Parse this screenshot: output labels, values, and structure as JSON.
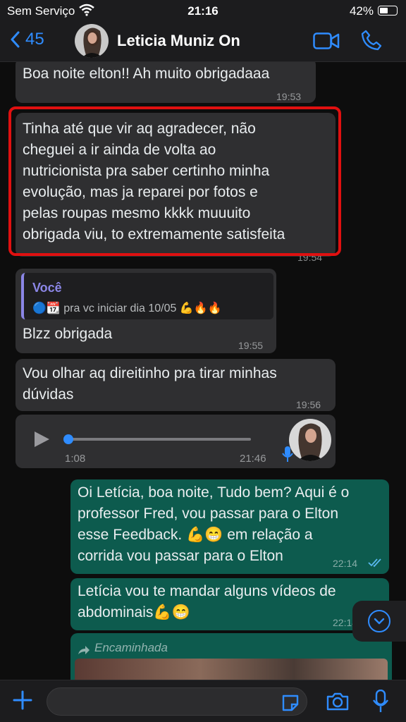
{
  "status_bar": {
    "carrier": "Sem Serviço",
    "time": "21:16",
    "battery": "42%"
  },
  "header": {
    "back_count": "45",
    "contact_name": "Leticia Muniz On"
  },
  "messages": [
    {
      "lines": [
        "Boa noite elton!! Ah muito obrigadaaa"
      ],
      "time": "19:53"
    },
    {
      "lines": [
        "Tinha até que vir aq agradecer, não",
        "cheguei a ir ainda de volta ao",
        "nutricionista pra saber certinho minha",
        "evolução, mas ja reparei por fotos e",
        "pelas roupas mesmo kkkk muuuito",
        "obrigada viu, to extremamente satisfeita"
      ],
      "time": "19:54"
    },
    {
      "quote_author": "Você",
      "quote_text": "🔵📆 pra vc iniciar dia 10/05 💪🔥🔥",
      "lines": [
        "Blzz obrigada"
      ],
      "time": "19:55"
    },
    {
      "lines": [
        "Vou olhar aq direitinho pra tirar minhas",
        "dúvidas"
      ],
      "time": "19:56"
    },
    {
      "voice_duration": "1:08",
      "time": "21:46"
    },
    {
      "lines": [
        "Oi Letícia, boa noite, Tudo bem? Aqui é o",
        "professor Fred, vou passar para o Elton",
        "esse Feedback. 💪😁 em relação a",
        "corrida vou passar para o Elton"
      ],
      "time": "22:14"
    },
    {
      "lines": [
        "Letícia vou te mandar alguns vídeos de",
        "abdominais💪😁"
      ],
      "time": "22:14"
    },
    {
      "forwarded_label": "Encaminhada"
    }
  ],
  "composer": {
    "placeholder": ""
  },
  "colors": {
    "accent": "#2f8cff",
    "incoming_bubble": "#2f2f31",
    "outgoing_bubble": "#0d5b4e",
    "highlight": "#e01010",
    "quote_author": "#8b86e6"
  },
  "icons": [
    "wifi-icon",
    "battery-icon",
    "back-chevron-icon",
    "video-call-icon",
    "phone-icon",
    "play-icon",
    "microphone-icon",
    "read-receipt-icon",
    "forward-icon",
    "chevron-down-icon",
    "plus-icon",
    "sticker-icon",
    "camera-icon"
  ]
}
